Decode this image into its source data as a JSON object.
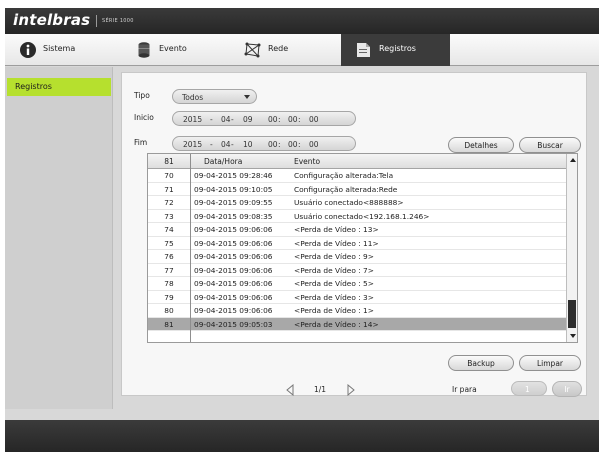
{
  "brand": {
    "logo": "intelbras",
    "series": "SÉRIE 1000"
  },
  "tabs": [
    {
      "label": "Sistema",
      "icon": "info-icon"
    },
    {
      "label": "Evento",
      "icon": "cylinder-icon"
    },
    {
      "label": "Rede",
      "icon": "network-icon"
    },
    {
      "label": "Registros",
      "icon": "log-icon",
      "active": true
    }
  ],
  "sidebar": {
    "items": [
      {
        "label": "Registros",
        "active": true
      }
    ]
  },
  "filters": {
    "tipo_label": "Tipo",
    "tipo_value": "Todos",
    "inicio_label": "Inicio",
    "inicio": {
      "year": "2015",
      "month": "04",
      "day": "09",
      "hh": "00",
      "mm": "00",
      "ss": "00"
    },
    "fim_label": "Fim",
    "fim": {
      "year": "2015",
      "month": "04",
      "day": "10",
      "hh": "00",
      "mm": "00",
      "ss": "00"
    },
    "date_sep": "-",
    "time_sep": ":"
  },
  "buttons": {
    "detalhes": "Detalhes",
    "buscar": "Buscar",
    "backup": "Backup",
    "limpar": "Limpar",
    "ir": "Ir"
  },
  "table": {
    "headers": {
      "num": "81",
      "datetime": "Data/Hora",
      "event": "Evento"
    },
    "rows": [
      {
        "num": "70",
        "datetime": "09-04-2015 09:28:46",
        "event": "Configuração alterada:Tela"
      },
      {
        "num": "71",
        "datetime": "09-04-2015 09:10:05",
        "event": "Configuração alterada:Rede"
      },
      {
        "num": "72",
        "datetime": "09-04-2015 09:09:55",
        "event": "Usuário conectado<888888>"
      },
      {
        "num": "73",
        "datetime": "09-04-2015 09:08:35",
        "event": "Usuário conectado<192.168.1.246>"
      },
      {
        "num": "74",
        "datetime": "09-04-2015 09:06:06",
        "event": "<Perda de Vídeo : 13>"
      },
      {
        "num": "75",
        "datetime": "09-04-2015 09:06:06",
        "event": "<Perda de Vídeo : 11>"
      },
      {
        "num": "76",
        "datetime": "09-04-2015 09:06:06",
        "event": "<Perda de Vídeo : 9>"
      },
      {
        "num": "77",
        "datetime": "09-04-2015 09:06:06",
        "event": "<Perda de Vídeo : 7>"
      },
      {
        "num": "78",
        "datetime": "09-04-2015 09:06:06",
        "event": "<Perda de Vídeo : 5>"
      },
      {
        "num": "79",
        "datetime": "09-04-2015 09:06:06",
        "event": "<Perda de Vídeo : 3>"
      },
      {
        "num": "80",
        "datetime": "09-04-2015 09:06:06",
        "event": "<Perda de Vídeo : 1>"
      },
      {
        "num": "81",
        "datetime": "09-04-2015 09:05:03",
        "event": "<Perda de Vídeo : 14>"
      }
    ],
    "selected_row": "81"
  },
  "pager": {
    "page": "1/1",
    "goto_label": "Ir para",
    "goto_value": "1"
  },
  "colors": {
    "accent": "#b6e02e",
    "topbar": "#2e2e2e",
    "selected_row": "#a8a8a8"
  }
}
